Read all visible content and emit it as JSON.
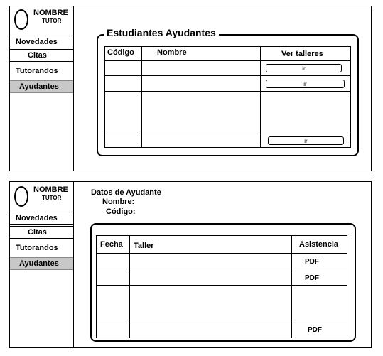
{
  "profile": {
    "name": "NOMBRE",
    "role": "TUTOR"
  },
  "nav": {
    "items": [
      {
        "label": "Novedades"
      },
      {
        "label": "Citas"
      },
      {
        "label": "Tutorandos"
      },
      {
        "label": "Ayudantes"
      }
    ]
  },
  "ayudantes": {
    "title": "Estudiantes Ayudantes",
    "columns": [
      "Código",
      "Nombre",
      "Ver talleres"
    ],
    "button_label": "ir"
  },
  "detalle": {
    "title": "Datos de Ayudante",
    "nombre_label": "Nombre:",
    "codigo_label": "Código:",
    "columns": [
      "Fecha",
      "Taller",
      "Asistencia"
    ],
    "pdf_label": "PDF"
  }
}
